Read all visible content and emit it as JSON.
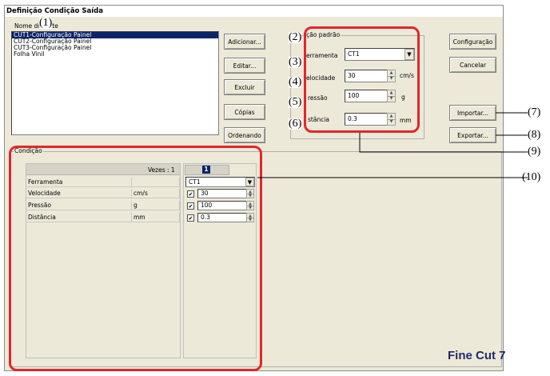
{
  "window": {
    "title": "Definição Condição Saída"
  },
  "list": {
    "header": "Nome do Mate",
    "items": [
      "CUT1-Configuração Painel",
      "CUT2-Configuração Painel",
      "CUT3-Configuração Painel",
      "Folha Vinil"
    ],
    "selected_index": 0
  },
  "buttons": {
    "add": "Adicionar...",
    "edit": "Editar...",
    "delete": "Excluir",
    "copy": "Cópias",
    "sort": "Ordenando",
    "config": "Configuração",
    "cancel": "Cancelar",
    "import": "Importar...",
    "export": "Exportar..."
  },
  "default_group": {
    "title": "ição padrão",
    "tool_label": "erramenta",
    "tool_value": "CT1",
    "speed_label": "elocidade",
    "speed_value": "30",
    "speed_unit": "cm/s",
    "pressure_label": "ressão",
    "pressure_value": "100",
    "pressure_unit": "g",
    "distance_label": "stância",
    "distance_value": "0.3",
    "distance_unit": "mm"
  },
  "condition": {
    "title": "Condição",
    "times_label": "Vezes : 1",
    "pass_tab": "1",
    "rows": [
      {
        "name": "Ferramenta",
        "unit": "",
        "value": "CT1",
        "kind": "dropdown"
      },
      {
        "name": "Velocidade",
        "unit": "cm/s",
        "value": "30",
        "kind": "spin",
        "checked": true
      },
      {
        "name": "Pressão",
        "unit": "g",
        "value": "100",
        "kind": "spin",
        "checked": true
      },
      {
        "name": "Distância",
        "unit": "mm",
        "value": "0.3",
        "kind": "spin",
        "checked": true
      }
    ]
  },
  "logo": "Fine Cut 7",
  "callouts": [
    "(1)",
    "(2)",
    "(3)",
    "(4)",
    "(5)",
    "(6)",
    "(7)",
    "(8)",
    "(9)",
    "(10)"
  ],
  "colors": {
    "highlight": "#e2262b",
    "selection": "#0a246a",
    "dialog_bg": "#ece9d8"
  }
}
